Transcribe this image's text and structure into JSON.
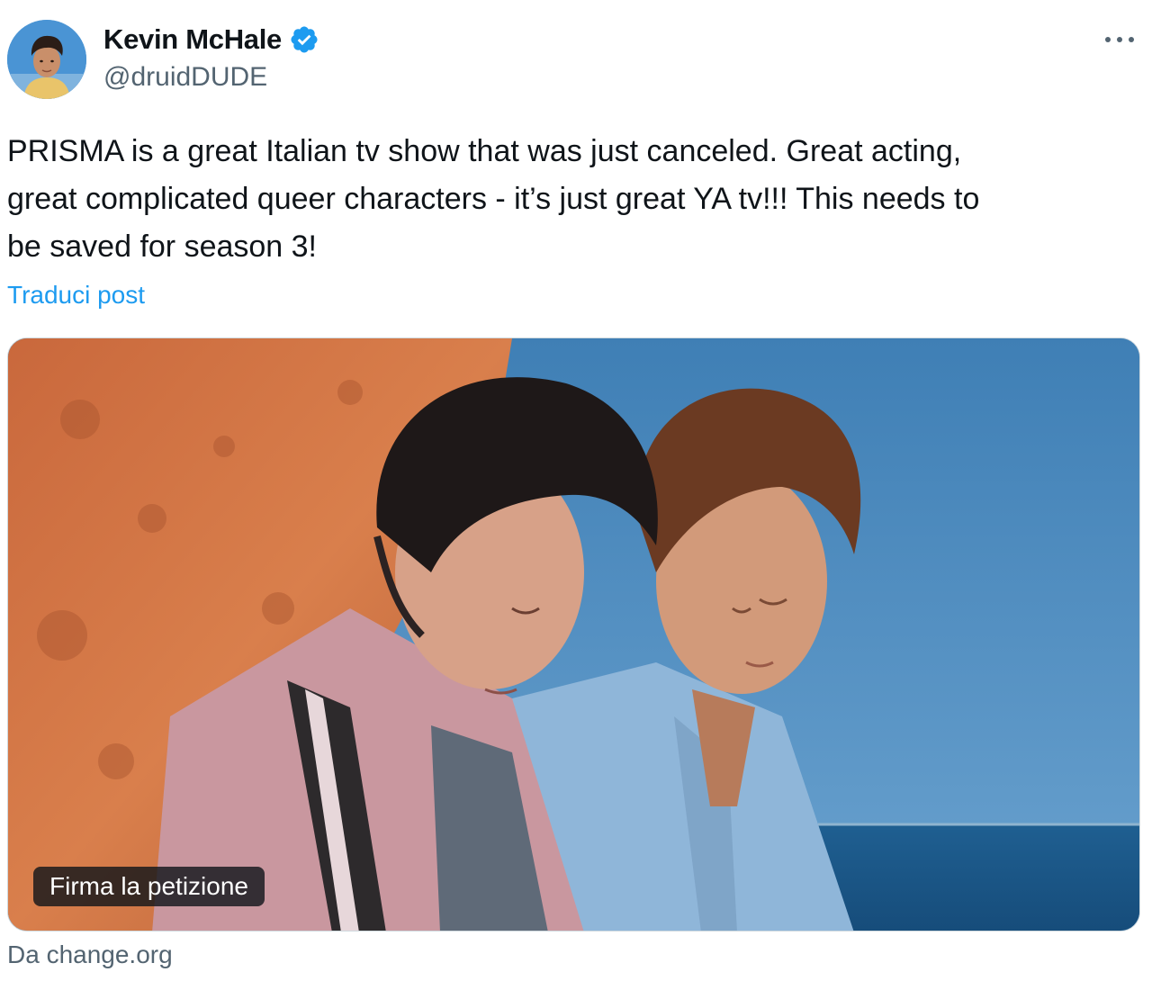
{
  "author": {
    "display_name": "Kevin McHale",
    "handle": "@druidDUDE",
    "verified": true,
    "avatar_icon": "profile-photo"
  },
  "more_icon": "more-horizontal-icon",
  "tweet": {
    "text": "PRISMA is a great Italian tv show that was just canceled. Great acting,\ngreat complicated queer characters - it’s just great YA tv!!! This needs to\nbe saved for season 3!",
    "translate_label": "Traduci post"
  },
  "card": {
    "badge_label": "Firma la petizione",
    "source_label": "Da change.org"
  },
  "colors": {
    "link": "#1d9bf0",
    "verified": "#1d9bf0",
    "secondary_text": "#536471",
    "border": "#cfd9de"
  }
}
